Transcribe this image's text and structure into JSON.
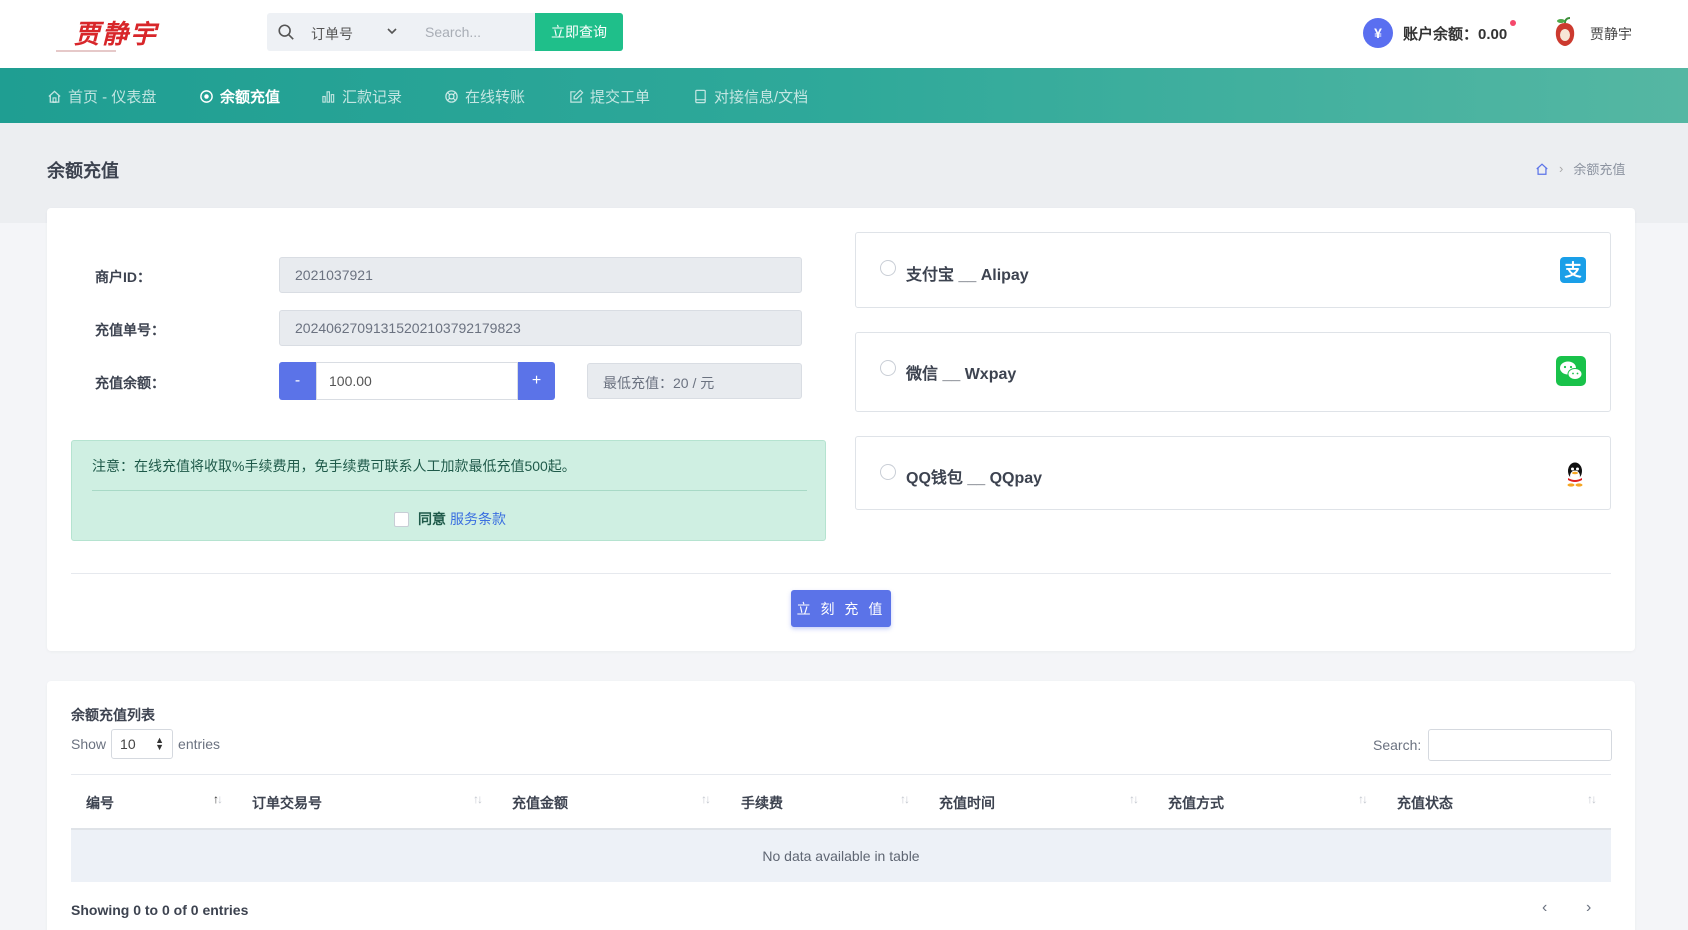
{
  "header": {
    "logo_text": "贾静宇",
    "search_type": "订单号",
    "search_placeholder": "Search...",
    "search_button": "立即查询",
    "balance_label": "账户余额：0.00",
    "balance_symbol": "¥",
    "user_name": "贾静宇"
  },
  "nav": {
    "items": [
      {
        "label": "首页 - 仪表盘",
        "icon": "home-icon"
      },
      {
        "label": "余额充值",
        "icon": "target-icon"
      },
      {
        "label": "汇款记录",
        "icon": "bar-chart-icon"
      },
      {
        "label": "在线转账",
        "icon": "lifebuoy-icon"
      },
      {
        "label": "提交工单",
        "icon": "edit-icon"
      },
      {
        "label": "对接信息/文档",
        "icon": "book-icon"
      }
    ],
    "active_index": 1
  },
  "page": {
    "title": "余额充值",
    "breadcrumb_current": "余额充值"
  },
  "form": {
    "merchant_label": "商户ID：",
    "merchant_value": "2021037921",
    "order_label": "充值单号：",
    "order_value": "20240627091315202103792179823",
    "amount_label": "充值余额：",
    "minus": "-",
    "amount_value": "100.00",
    "plus": "+",
    "min_label": "最低充值：20 / 元",
    "notice": "注意：在线充值将收取%手续费用，免手续费可联系人工加款最低充值500起。",
    "agree_text": "同意",
    "agree_link": "服务条款",
    "submit": "立 刻 充 值"
  },
  "payments": [
    {
      "label": "支付宝 __ Alipay",
      "icon": "alipay-icon",
      "color": "#1a9fe8"
    },
    {
      "label": "微信 __ Wxpay",
      "icon": "wechat-icon",
      "color": "#19c24a"
    },
    {
      "label": "QQ钱包 __ QQpay",
      "icon": "qq-penguin-icon",
      "color": "#111111"
    }
  ],
  "table": {
    "title": "余额充值列表",
    "show_prefix": "Show",
    "show_value": "10",
    "show_suffix": "entries",
    "search_label": "Search:",
    "columns": [
      "编号",
      "订单交易号",
      "充值金额",
      "手续费",
      "充值时间",
      "充值方式",
      "充值状态"
    ],
    "empty": "No data available in table",
    "showing": "Showing 0 to 0 of 0 entries",
    "prev": "‹",
    "next": "›"
  },
  "colors": {
    "accent": "#5b73e8",
    "nav_start": "#1f9e92",
    "nav_end": "#55b7a3",
    "search_button": "#1fbf8a",
    "notice_bg": "#cfefe2"
  }
}
